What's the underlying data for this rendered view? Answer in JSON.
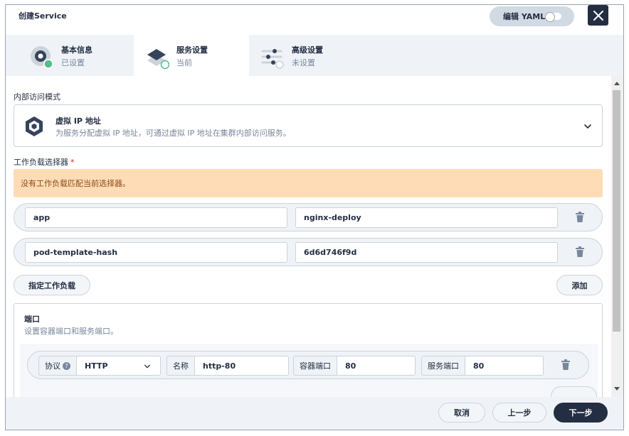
{
  "dialog": {
    "title": "创建Service"
  },
  "header": {
    "edit_yaml_label": "编辑 YAML"
  },
  "tabs": [
    {
      "title": "基本信息",
      "status": "已设置",
      "icon": "info-gear-icon",
      "state": "done"
    },
    {
      "title": "服务设置",
      "status": "当前",
      "icon": "layers-icon",
      "state": "current"
    },
    {
      "title": "高级设置",
      "status": "未设置",
      "icon": "sliders-icon",
      "state": "todo"
    }
  ],
  "access_mode": {
    "label": "内部访问模式",
    "selected_title": "虚拟 IP 地址",
    "selected_desc": "为服务分配虚拟 IP 地址，可通过虚拟 IP 地址在集群内部访问服务。"
  },
  "selector": {
    "label": "工作负载选择器",
    "required_mark": "*",
    "warning": "没有工作负载匹配当前选择器。",
    "rows": [
      {
        "key": "app",
        "value": "nginx-deploy"
      },
      {
        "key": "pod-template-hash",
        "value": "6d6d746f9d"
      }
    ],
    "specify_button": "指定工作负载",
    "add_button": "添加"
  },
  "ports": {
    "title": "端口",
    "desc": "设置容器端口和服务端口。",
    "protocol_label": "协议",
    "help_mark": "?",
    "name_label": "名称",
    "container_port_label": "容器端口",
    "service_port_label": "服务端口",
    "rows": [
      {
        "protocol": "HTTP",
        "name": "http-80",
        "container_port": "80",
        "service_port": "80"
      }
    ]
  },
  "footer": {
    "cancel": "取消",
    "prev": "上一步",
    "next": "下一步"
  },
  "colors": {
    "accent": "#242e42",
    "success": "#55bc8a",
    "warning_bg": "#fedcb5",
    "warning_text": "#8c4a19"
  }
}
